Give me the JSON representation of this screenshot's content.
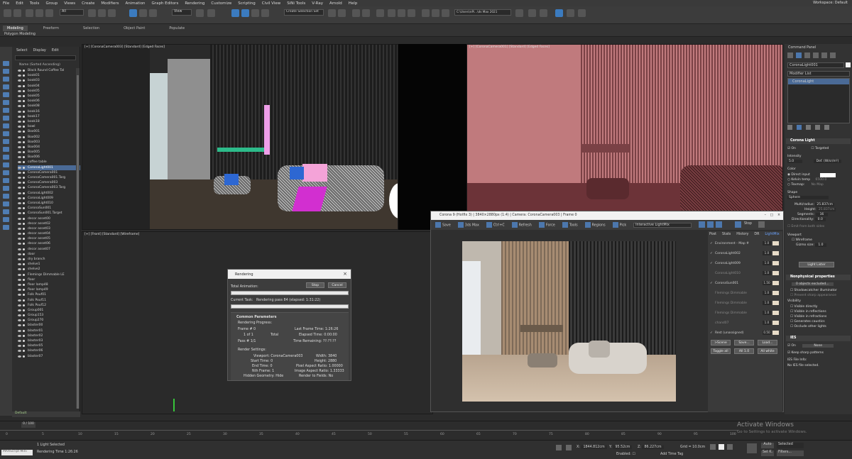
{
  "menu": [
    "File",
    "Edit",
    "Tools",
    "Group",
    "Views",
    "Create",
    "Modifiers",
    "Animation",
    "Graph Editors",
    "Rendering",
    "Customize",
    "Scripting",
    "Civil View",
    "SiNi Tools",
    "V-Ray",
    "Arnold",
    "Help"
  ],
  "workspace": {
    "label": "Workspace:",
    "value": "Default"
  },
  "toolbar": {
    "selection_filter": "All",
    "view": "View",
    "create_selection_set": "Create Selection Set",
    "path": "C:\\Users\\nPi...\\ds Max 2021"
  },
  "ribbon": {
    "tabs": [
      "Modeling",
      "Freeform",
      "Selection",
      "Object Paint",
      "Populate"
    ],
    "sub": "Polygon Modeling"
  },
  "explorer": {
    "tabs": [
      "Select",
      "Display",
      "Edit"
    ],
    "header": "Name (Sorted Ascending)",
    "items": [
      "Black Round Coffee Tal",
      "book01",
      "book03",
      "book04",
      "book05",
      "book05",
      "book06",
      "book08",
      "book16",
      "book17",
      "book18",
      "bowl",
      "Box001",
      "Box002",
      "Box003",
      "Box004",
      "Box005",
      "Box006",
      "coffee table",
      "CoronaLight001",
      "CoronaCamera001",
      "CoronaCamera001.Targ",
      "CoronaCamera003",
      "CoronaCamera003.Targ",
      "CoronaLight002",
      "CoronaLight009",
      "CoronaLight010",
      "CoronaSun001",
      "CoronaSun001.Target",
      "decor asset00",
      "decor asset02",
      "decor asset03",
      "decor asset04",
      "decor asset05",
      "decor asset06",
      "decor asset07",
      "door",
      "dry branch",
      "shelve1",
      "shelve2",
      "Flemings Dimmable LE",
      "floor",
      "floor lamp48",
      "floor lamp49",
      "Folk Pouf01",
      "Folk Pouf11",
      "Folk Pouf12",
      "Group001",
      "Group153",
      "Group270",
      "blaster00",
      "blaster01",
      "blaster02",
      "blaster03",
      "blaster05",
      "blaster06",
      "blaster07"
    ],
    "selected_index": 19,
    "footer": "Default"
  },
  "viewports": {
    "vp1": "[+] [CoronaCamera003] [Standard] [Edged Faces]",
    "vp2": "[+] [CoronaCamera001] [Standard] [Edged Faces]",
    "vp3": "[+] [Front] [Standard] [Wireframe]"
  },
  "rendering_dialog": {
    "title": "Rendering",
    "stop": "Stop",
    "cancel": "Cancel",
    "total_animation": "Total Animation:",
    "current_task_label": "Current Task:",
    "current_task": "Rendering pass 84 (elapsed: 1:31:22)",
    "section": "Common Parameters",
    "progress_label": "Rendering Progress:",
    "frame_label": "Frame #",
    "frame": "0",
    "of_label": "1 of",
    "of": "1",
    "total": "Total",
    "pass_label": "Pass #",
    "pass": "1/1",
    "last_frame_time_label": "Last Frame Time:",
    "last_frame_time": "1:26:26",
    "elapsed_time_label": "Elapsed Time:",
    "elapsed_time": "0:00:00",
    "time_remaining_label": "Time Remaining:",
    "time_remaining": "??:??:??",
    "render_settings": "Render Settings:",
    "viewport_label": "Viewport:",
    "viewport": "CoronaCamera003",
    "width_label": "Width:",
    "width": "3840",
    "start_time_label": "Start Time:",
    "start_time": "0",
    "height_label": "Height:",
    "height": "2880",
    "end_time_label": "End Time:",
    "end_time": "0",
    "par_label": "Pixel Aspect Ratio:",
    "par": "1.00000",
    "nth_label": "Nth Frame:",
    "nth": "1",
    "iar_label": "Image Aspect Ratio:",
    "iar": "1.33333",
    "hidden_label": "Hidden Geometry:",
    "hidden": "Hide",
    "fields_label": "Render to Fields:",
    "fields": "No"
  },
  "vfb": {
    "title": "Corona 9 (Hotfix 3) | 3840×2880px (1:4) | Camera: CoronaCamera003 | Frame 0",
    "toolbar": [
      "Save",
      "3ds Max",
      "Ctrl+C",
      "Refresh",
      "Force",
      "Tools",
      "Regions",
      "Pick",
      "Interactive LightMix"
    ],
    "stop": "Stop",
    "side_tabs": [
      "Post",
      "Stats",
      "History",
      "DR",
      "LightMix"
    ],
    "lights": [
      {
        "name": "Environment - Map #",
        "on": true,
        "val": "1.0"
      },
      {
        "name": "CoronaLight002",
        "on": true,
        "val": "1.0"
      },
      {
        "name": "CoronaLight009",
        "on": true,
        "val": "1.0"
      },
      {
        "name": "CoronaLight010",
        "on": false,
        "val": "1.0"
      },
      {
        "name": "CoronaSun001",
        "on": true,
        "val": "1.50"
      },
      {
        "name": "Flemings Dimmable",
        "on": false,
        "val": "1.0"
      },
      {
        "name": "Flemings Dimmable",
        "on": false,
        "val": "1.0"
      },
      {
        "name": "Flemings Dimmable",
        "on": false,
        "val": "1.0"
      },
      {
        "name": "chand07",
        "on": false,
        "val": "1.0"
      },
      {
        "name": "Rest (unassigned)",
        "on": true,
        "val": "0.50"
      }
    ],
    "buttons_row1": [
      ">Scene",
      "Save...",
      "Load..."
    ],
    "buttons_row2": [
      "Toggle all",
      "All 1.0",
      "All white"
    ]
  },
  "command_panel": {
    "title": "Command Panel",
    "object": "CoronaLight001",
    "modifier_list": "Modifier List",
    "stack_item": "CoronaLight",
    "sect_light": "Corona Light",
    "on": "On",
    "targeted": "Targeted",
    "intensity_label": "Intensity",
    "intensity": "5.0",
    "units": "Def. (W/sr/m²)",
    "color": "Color",
    "direct_input": "Direct input",
    "kelvin": "Kelvin temp",
    "kelvin_val": "6500.0",
    "texmap": "Texmap:",
    "texmap_val": "No Map",
    "shape_label": "Shape",
    "shape": "Sphere",
    "multiradius": "Multi/radius:",
    "radius": "25.837cm",
    "height_label": "Height:",
    "height": "25.837cm",
    "segments_label": "Segments:",
    "segments": "16",
    "directionality_label": "Directionality:",
    "directionality": "0.0",
    "emit_both": "Emit from both sides",
    "viewport_label": "Viewport",
    "wireframe": "Wireframe",
    "gizmo_label": "Gizmo size:",
    "gizmo": "1.0",
    "light_lister": "Light Lister",
    "sect_nonphys": "Nonphysical properties",
    "excluded": "0 objects excluded...",
    "shadowcatcher": "Shadowcatcher illuminator",
    "prevent": "Prevent sharp appearance",
    "visibility": "Visibility",
    "vis_direct": "Visible directly",
    "vis_refl": "Visible in reflections",
    "vis_refr": "Visible in refractions",
    "caustics": "Generates caustics",
    "occlude": "Occlude other lights",
    "sect_ies": "IES",
    "ies_on": "On",
    "ies_none": "None",
    "keep_sharp": "Keep sharp patterns",
    "ies_info": "IES File Info:",
    "ies_none_sel": "No IES file selected."
  },
  "timeline": {
    "frame": "0 / 100",
    "ticks": [
      "0",
      "5",
      "10",
      "15",
      "20",
      "25",
      "30",
      "35",
      "40",
      "45",
      "50",
      "55",
      "60",
      "65",
      "70",
      "75",
      "80",
      "85",
      "90",
      "95",
      "100"
    ]
  },
  "status": {
    "script": "MAXScript Mini",
    "light_selected": "1 Light Selected",
    "rendering_time": "Rendering Time  1:26:26",
    "x": "1844.812cm",
    "y": "95.52cm",
    "z": "86.227cm",
    "grid": "Grid = 10.0cm",
    "enabled": "Enabled:",
    "add_time_tag": "Add Time Tag",
    "auto": "Auto",
    "set_key": "Set K.",
    "selected": "Selected",
    "filters": "Filters..."
  },
  "watermark": {
    "title": "Activate Windows",
    "sub": "Go to Settings to activate Windows."
  }
}
